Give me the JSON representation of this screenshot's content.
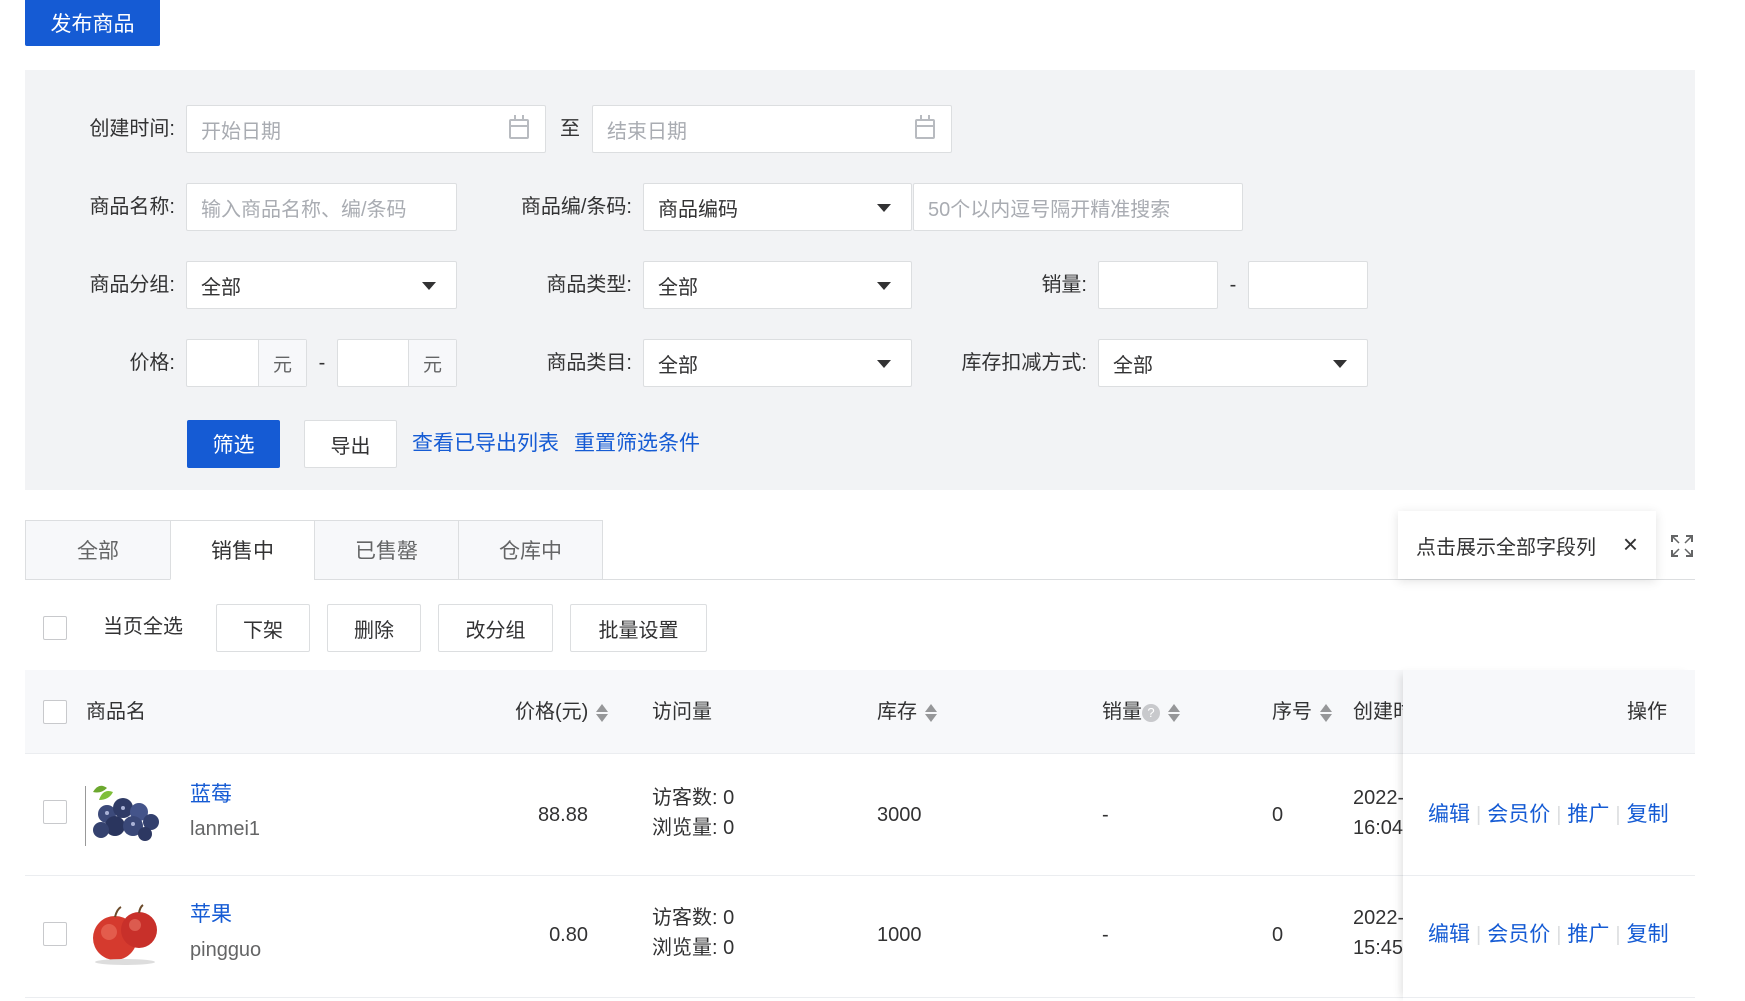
{
  "top": {
    "publish_button": "发布商品"
  },
  "filters": {
    "create_time_label": "创建时间:",
    "start_date_placeholder": "开始日期",
    "to_label": "至",
    "end_date_placeholder": "结束日期",
    "name_label": "商品名称:",
    "name_placeholder": "输入商品名称、编/条码",
    "code_label": "商品编/条码:",
    "code_select_value": "商品编码",
    "code_placeholder": "50个以内逗号隔开精准搜索",
    "group_label": "商品分组:",
    "group_value": "全部",
    "type_label": "商品类型:",
    "type_value": "全部",
    "sales_label": "销量:",
    "sales_dash": "-",
    "price_label": "价格:",
    "price_unit": "元",
    "price_dash": "-",
    "category_label": "商品类目:",
    "category_value": "全部",
    "stock_label": "库存扣减方式:",
    "stock_value": "全部",
    "filter_button": "筛选",
    "export_button": "导出",
    "view_exported_link": "查看已导出列表",
    "reset_link": "重置筛选条件"
  },
  "tabs": [
    {
      "label": "全部"
    },
    {
      "label": "销售中"
    },
    {
      "label": "已售罄"
    },
    {
      "label": "仓库中"
    }
  ],
  "tooltip": {
    "text": "点击展示全部字段列",
    "close": "×"
  },
  "batch": {
    "select_all_label": "当页全选",
    "offline_button": "下架",
    "delete_button": "删除",
    "change_group_button": "改分组",
    "batch_set_button": "批量设置"
  },
  "table": {
    "headers": {
      "name": "商品名",
      "price": "价格(元)",
      "visits": "访问量",
      "stock": "库存",
      "sales": "销量",
      "sales_help": "?",
      "seq": "序号",
      "created": "创建时",
      "actions": "操作"
    },
    "rows": [
      {
        "name": "蓝莓",
        "code": "lanmei1",
        "price": "88.88",
        "visitors": "访客数: 0",
        "views": "浏览量: 0",
        "stock": "3000",
        "sales": "-",
        "seq": "0",
        "created_date": "2022-",
        "created_time": "16:04",
        "image": "blueberry"
      },
      {
        "name": "苹果",
        "code": "pingguo",
        "price": "0.80",
        "visitors": "访客数: 0",
        "views": "浏览量: 0",
        "stock": "1000",
        "sales": "-",
        "seq": "0",
        "created_date": "2022-",
        "created_time": "15:45",
        "image": "apple"
      }
    ],
    "actions": [
      "编辑",
      "会员价",
      "推广",
      "复制"
    ]
  }
}
